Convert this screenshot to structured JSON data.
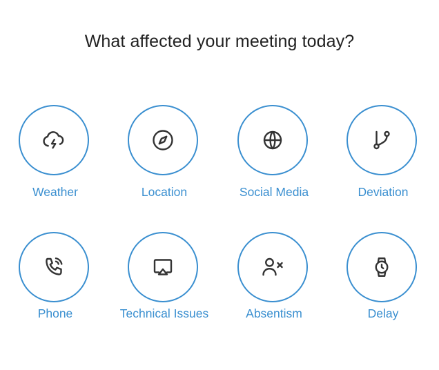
{
  "title": "What affected your meeting today?",
  "accent_color": "#3a8fd0",
  "icon_color": "#333333",
  "options": [
    {
      "label": "Weather",
      "icon": "cloud-lightning-icon"
    },
    {
      "label": "Location",
      "icon": "compass-icon"
    },
    {
      "label": "Social Media",
      "icon": "globe-icon"
    },
    {
      "label": "Deviation",
      "icon": "git-branch-icon"
    },
    {
      "label": "Phone",
      "icon": "phone-ringing-icon"
    },
    {
      "label": "Technical Issues",
      "icon": "screen-cast-icon"
    },
    {
      "label": "Absentism",
      "icon": "user-remove-icon"
    },
    {
      "label": "Delay",
      "icon": "watch-icon"
    }
  ]
}
